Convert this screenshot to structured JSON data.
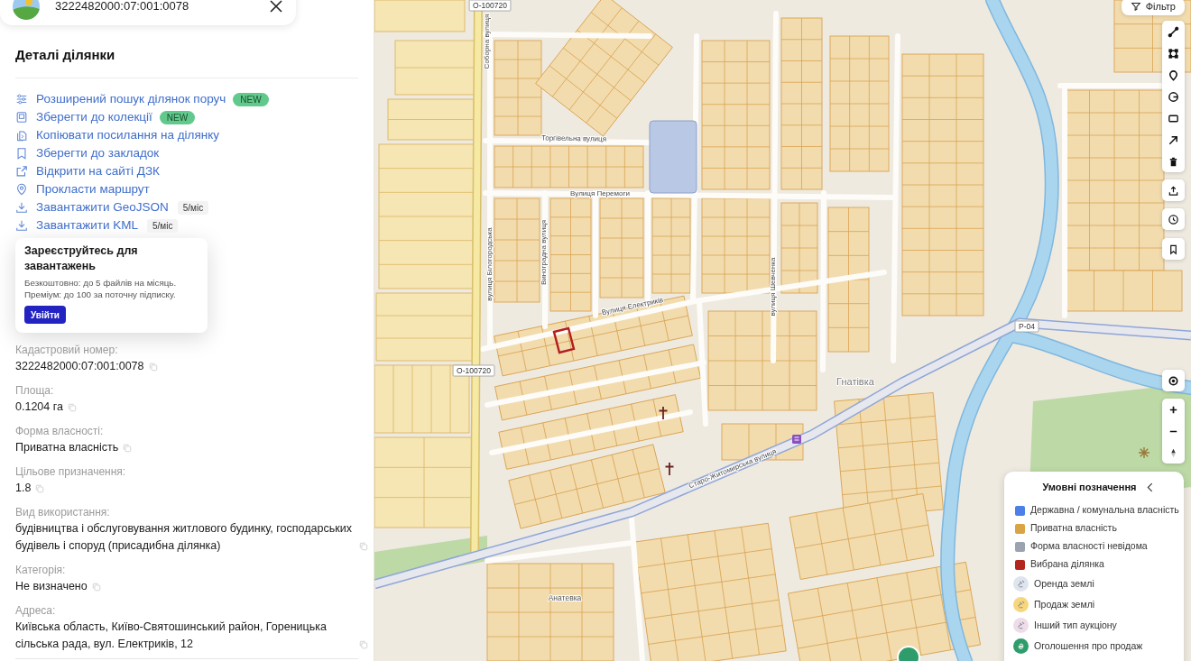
{
  "search": {
    "value": "3222482000:07:001:0078"
  },
  "details": {
    "title": "Деталі ділянки",
    "actions": [
      {
        "label": "Розширений пошук ділянок поруч",
        "badge": {
          "kind": "new",
          "text": "NEW"
        }
      },
      {
        "label": "Зберегти до колекції",
        "badge": {
          "kind": "new",
          "text": "NEW"
        }
      },
      {
        "label": "Копіювати посилання на ділянку"
      },
      {
        "label": "Зберегти до закладок"
      },
      {
        "label": "Відкрити на сайті ДЗК"
      },
      {
        "label": "Прокласти маршрут"
      },
      {
        "label": "Завантажити GeoJSON",
        "badge": {
          "kind": "quota",
          "text": "5/міс"
        }
      },
      {
        "label": "Завантажити KML",
        "badge": {
          "kind": "quota",
          "text": "5/міс"
        }
      }
    ]
  },
  "signup_popup": {
    "title": "Зареєструйтесь для завантажень",
    "lines": [
      "Безкоштовно: до 5 файлів на місяць.",
      "Преміум: до 100 за поточну підписку."
    ],
    "button": "Увійти"
  },
  "fields": [
    {
      "label": "Кадастровий номер:",
      "value": "3222482000:07:001:0078"
    },
    {
      "label": "Площа:",
      "value": "0.1204 га"
    },
    {
      "label": "Форма власності:",
      "value": "Приватна власність"
    },
    {
      "label": "Цільове призначення:",
      "value": "1.8"
    },
    {
      "label": "Вид використання:",
      "value": "будівництва і обслуговування житлового будинку, господарських будівель і споруд (присадибна ділянка)"
    },
    {
      "label": "Категорія:",
      "value": "Не визначено"
    },
    {
      "label": "Адреса:",
      "value": "Київська область, Київо-Святошинський район, Гореницька сільська рада, вул. Електриків, 12"
    }
  ],
  "map": {
    "filter_button": "Фільтр",
    "labels": [
      {
        "kind": "shield",
        "text": "О-100720"
      },
      {
        "kind": "street",
        "text": "Соборна вулиця"
      },
      {
        "kind": "street",
        "text": "Торгівельна вулиця"
      },
      {
        "kind": "street",
        "text": "Вулиця Перемоги"
      },
      {
        "kind": "street",
        "text": "вулиця Білогородська"
      },
      {
        "kind": "street",
        "text": "Виноградна вулиця"
      },
      {
        "kind": "street",
        "text": "Вулиця Електриків"
      },
      {
        "kind": "shield",
        "text": "О-100720"
      },
      {
        "kind": "street",
        "text": "Старо-Житомирська вулиця"
      },
      {
        "kind": "street",
        "text": "вулиця Шевченка"
      },
      {
        "kind": "village",
        "text": "Гнатівка"
      },
      {
        "kind": "place",
        "text": "Анатевка"
      },
      {
        "kind": "shield",
        "text": "Р-04"
      }
    ]
  },
  "legend": {
    "title": "Умовні позначення",
    "items": [
      {
        "kind": "swatch",
        "label": "Державна / комунальна власність",
        "color": "#4d7fe8"
      },
      {
        "kind": "swatch",
        "label": "Приватна власність",
        "color": "#d9a443"
      },
      {
        "kind": "swatch",
        "label": "Форма власності невідома",
        "color": "#9ba3b0"
      },
      {
        "kind": "swatch",
        "label": "Вибрана ділянка",
        "color": "#b3261e"
      },
      {
        "kind": "auction-marker",
        "label": "Оренда землі",
        "color": "#dfe5ee"
      },
      {
        "kind": "auction-marker",
        "label": "Продаж землі",
        "color": "#f6d77c"
      },
      {
        "kind": "auction-marker",
        "label": "Інший тип аукціону",
        "color": "#eedde8"
      },
      {
        "kind": "sale-marker",
        "label": "Оголошення про продаж",
        "color": "#2e9d6b"
      }
    ]
  }
}
